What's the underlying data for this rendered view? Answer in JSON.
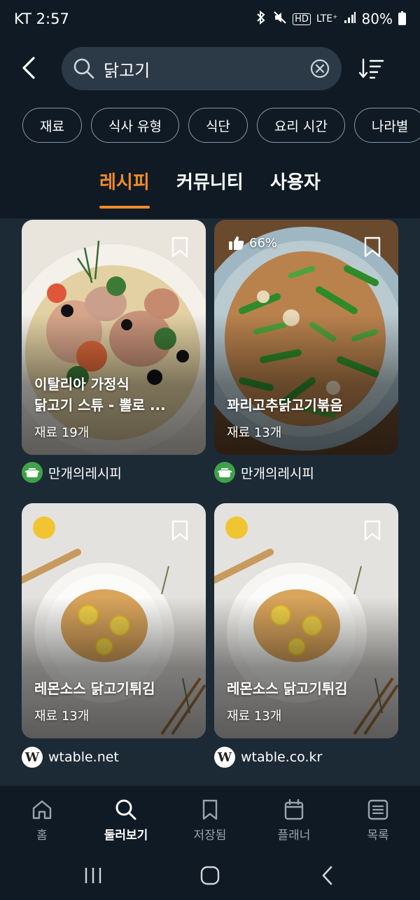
{
  "status_bar": {
    "carrier_time": "KT 2:57",
    "hd_badge": "HD",
    "network": "LTE⁺",
    "battery": "80%"
  },
  "search": {
    "query": "닭고기"
  },
  "filters": [
    "재료",
    "식사 유형",
    "식단",
    "요리 시간",
    "나라별"
  ],
  "tabs": {
    "recipes": "레시피",
    "community": "커뮤니티",
    "users": "사용자"
  },
  "cards": [
    {
      "title_line1": "이탈리아 가정식",
      "title_line2": "닭고기 스튜 - 뽈로 ...",
      "ingredients": "재료 19개",
      "author": "만개의레시피",
      "like": ""
    },
    {
      "title_line1": "꽈리고추닭고기볶음",
      "ingredients": "재료 13개",
      "author": "만개의레시피",
      "like": "66%"
    },
    {
      "title_line1": "레몬소스 닭고기튀김",
      "ingredients": "재료 13개",
      "author": "wtable.net"
    },
    {
      "title_line1": "레몬소스 닭고기튀김",
      "ingredients": "재료 13개",
      "author": "wtable.co.kr"
    }
  ],
  "avatar_letter": "W",
  "bottom_nav": {
    "home": "홈",
    "browse": "둘러보기",
    "saved": "저장됨",
    "planner": "플래너",
    "list": "목록"
  },
  "colors": {
    "accent": "#f08a2c",
    "background": "#0f1a24",
    "search_bg": "#2c3a48",
    "chip_border": "#8a96a2"
  },
  "icons": [
    "back-arrow-icon",
    "search-icon",
    "clear-icon",
    "sort-icon",
    "bookmark-icon",
    "thumbs-up-icon",
    "home-icon",
    "browse-search-icon",
    "saved-bookmark-icon",
    "calendar-icon",
    "list-icon"
  ]
}
